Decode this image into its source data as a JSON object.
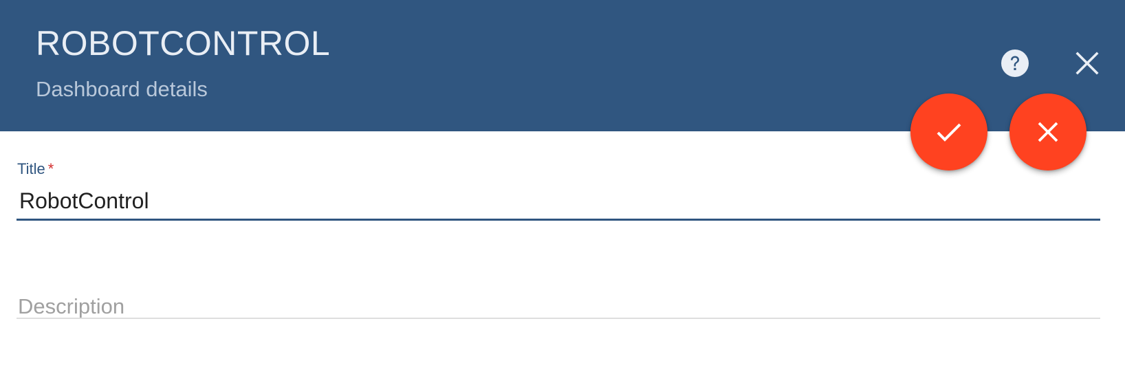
{
  "header": {
    "title": "ROBOTCONTROL",
    "subtitle": "Dashboard details",
    "background_color": "#305680",
    "help_icon": "help-circle-icon",
    "close_icon": "close-icon"
  },
  "actions": {
    "save_icon": "check-icon",
    "cancel_icon": "close-icon",
    "fab_color": "#ff4220"
  },
  "form": {
    "title_field": {
      "label": "Title",
      "required_marker": "*",
      "value": "RobotControl"
    },
    "description_field": {
      "placeholder": "Description",
      "value": ""
    }
  }
}
